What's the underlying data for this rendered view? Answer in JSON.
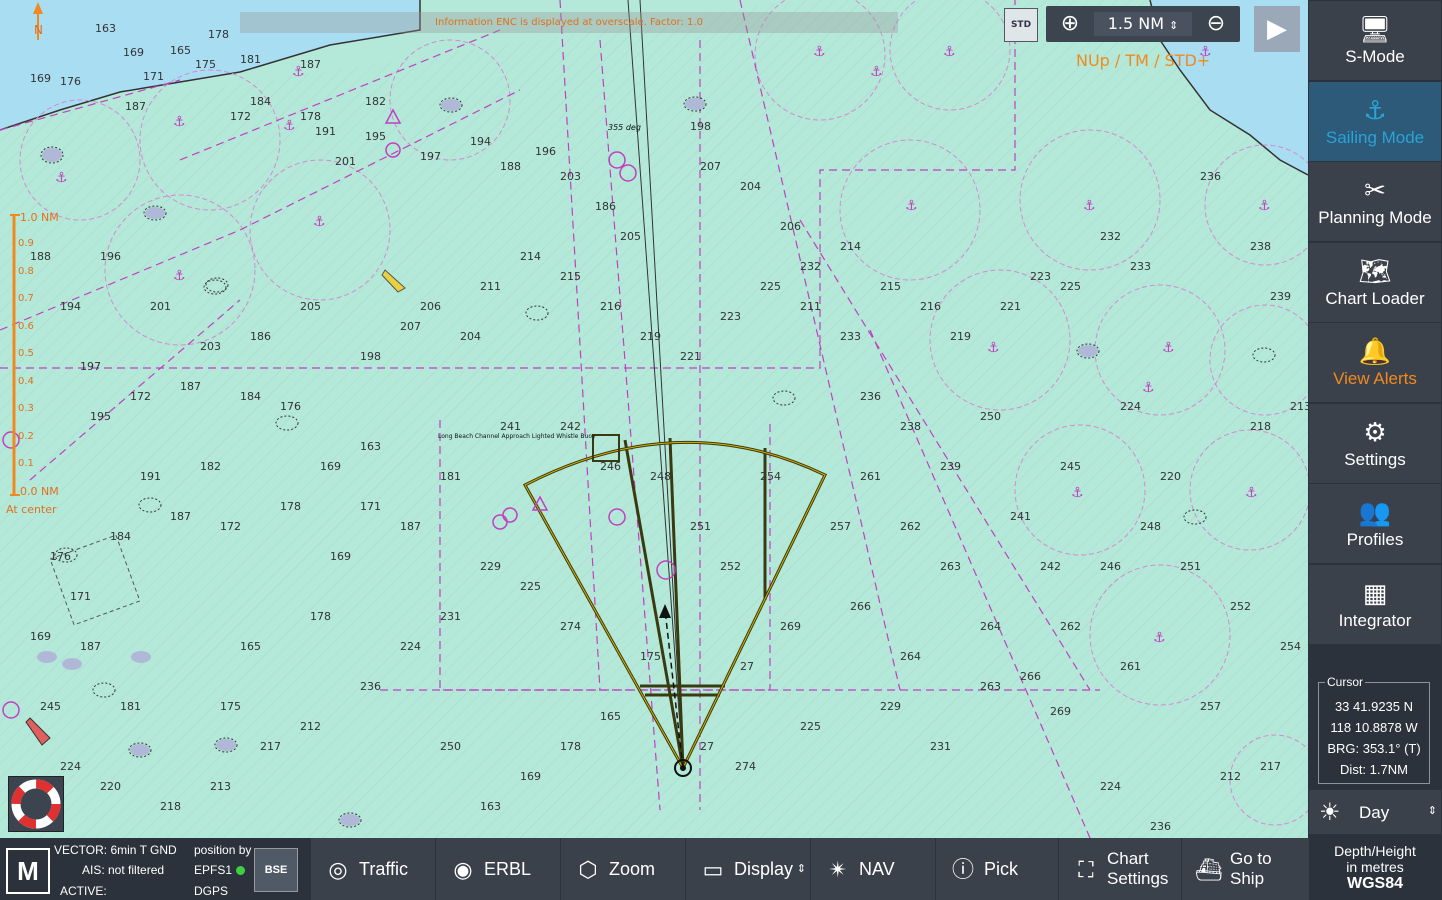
{
  "chart": {
    "overscale_info": "Information ENC is displayed at overscale. Factor: 1.0",
    "std_label": "STD",
    "zoom_value": "1.5 NM",
    "orientation": "NUp / TM / STD+",
    "scale_top": "1.0 NM",
    "scale_bottom": "0.0 NM",
    "scale_ticks": [
      "0.9",
      "0.8",
      "0.7",
      "0.6",
      "0.5",
      "0.4",
      "0.3",
      "0.2",
      "0.1"
    ],
    "at_center": "At center",
    "north_label": "N",
    "heading_label": "355 deg",
    "buoy_label": "Long Beach Channel Approach Lighted Whistle Buoy",
    "soundings": [
      "163",
      "169",
      "178",
      "165",
      "175",
      "181",
      "187",
      "171",
      "169",
      "176",
      "184",
      "187",
      "172",
      "178",
      "182",
      "191",
      "195",
      "197",
      "194",
      "188",
      "196",
      "201",
      "203",
      "186",
      "205",
      "198",
      "207",
      "204",
      "206",
      "211",
      "214",
      "215",
      "216",
      "219",
      "221",
      "223",
      "225",
      "232",
      "233",
      "236",
      "238",
      "239",
      "241",
      "242",
      "246",
      "248",
      "251",
      "252",
      "254",
      "257",
      "261",
      "262",
      "263",
      "264",
      "266",
      "269",
      "27",
      "274",
      "225",
      "229",
      "231",
      "224",
      "236",
      "212",
      "217",
      "213",
      "218",
      "220",
      "224",
      "245",
      "250"
    ]
  },
  "sidebar": {
    "items": [
      {
        "label": "S-Mode",
        "icon": "monitor-icon"
      },
      {
        "label": "Sailing Mode",
        "icon": "ship-icon"
      },
      {
        "label": "Planning Mode",
        "icon": "tools-icon"
      },
      {
        "label": "Chart Loader",
        "icon": "chart-loader-icon"
      },
      {
        "label": "View Alerts",
        "icon": "alert-bell-icon"
      },
      {
        "label": "Settings",
        "icon": "gear-icon"
      },
      {
        "label": "Profiles",
        "icon": "profiles-icon"
      },
      {
        "label": "Integrator",
        "icon": "integrator-icon"
      }
    ],
    "cursor": {
      "title": "Cursor",
      "lat": "33 41.9235 N",
      "lon": "118 10.8878 W",
      "brg": "BRG: 353.1° (T)",
      "dist": "Dist:  1.7NM"
    },
    "day_mode": "Day",
    "depth_label": "Depth/Height",
    "depth_unit": "in metres",
    "datum": "WGS84"
  },
  "bottom": {
    "logo": "M",
    "vector": "VECTOR: 6min T GND",
    "ais": "AIS: not filtered",
    "active": "ACTIVE:",
    "position_by": "position by",
    "epfs": "EPFS1",
    "dgps": "DGPS",
    "bse": "BSE",
    "buttons": [
      {
        "label": "Traffic",
        "icon": "traffic-icon"
      },
      {
        "label": "ERBL",
        "icon": "erbl-icon"
      },
      {
        "label": "Zoom",
        "icon": "zoom-icon"
      },
      {
        "label": "Display",
        "icon": "display-icon"
      },
      {
        "label": "NAV",
        "icon": "nav-icon"
      },
      {
        "label": "Pick",
        "icon": "pick-icon"
      }
    ],
    "chart_settings_1": "Chart",
    "chart_settings_2": "Settings",
    "go_to_ship_1": "Go to",
    "go_to_ship_2": "Ship"
  },
  "colors": {
    "sea": "#b4e9d9",
    "land": "#a9ddf1",
    "accent": "#2aa3d8",
    "alert": "#f08a20",
    "magenta": "#c040c0"
  }
}
